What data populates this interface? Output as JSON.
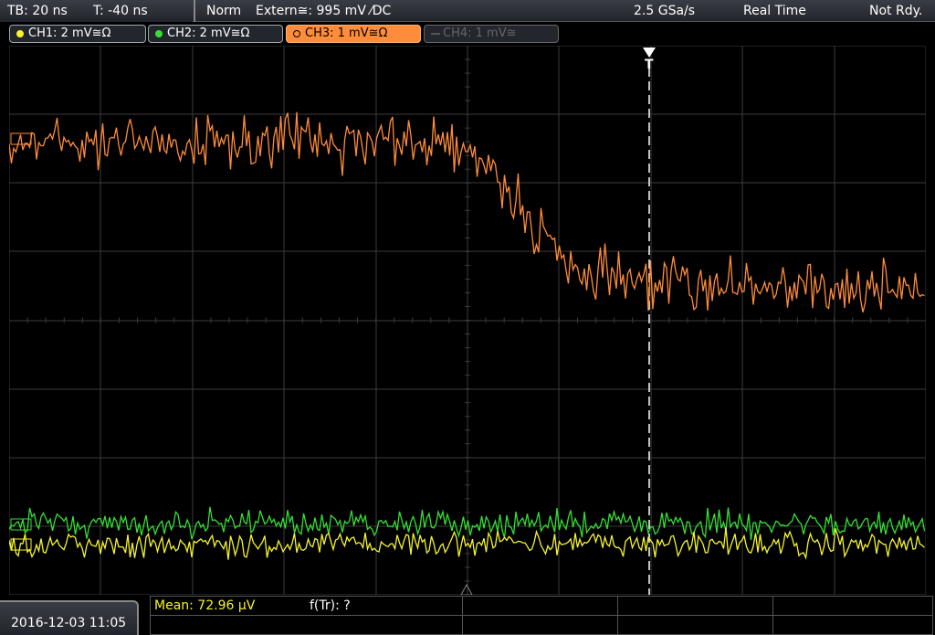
{
  "header": {
    "timebase": "TB: 20 ns",
    "trig_time": "T: -40 ns",
    "mode": "Norm",
    "trigger": "Extern≅: 995 mV ⁄DC",
    "sample_rate": "2.5 GSa/s",
    "acq_mode": "Real Time",
    "status": "Not Rdy."
  },
  "channels": [
    {
      "label": "CH1: 2 mV≅Ω",
      "color": "#f5f52a",
      "active": true
    },
    {
      "label": "CH2: 2 mV≅Ω",
      "color": "#33e033",
      "active": true
    },
    {
      "label": "CH3: 1 mV≅Ω",
      "color": "#ff8c3a",
      "active": true,
      "selected": true
    },
    {
      "label": "CH4: 1 mV≅",
      "color": "#777777",
      "active": false
    }
  ],
  "markers": {
    "trigger_marker": "T"
  },
  "footer": {
    "datetime": "2016-12-03 11:05",
    "measurement1": "Mean: 72.96 µV",
    "measurement2": "f(Tr): ?"
  },
  "colors": {
    "ch1": "#f5f52a",
    "ch2": "#33e033",
    "ch3": "#ff8c3a",
    "grid": "#3c3c3c"
  }
}
